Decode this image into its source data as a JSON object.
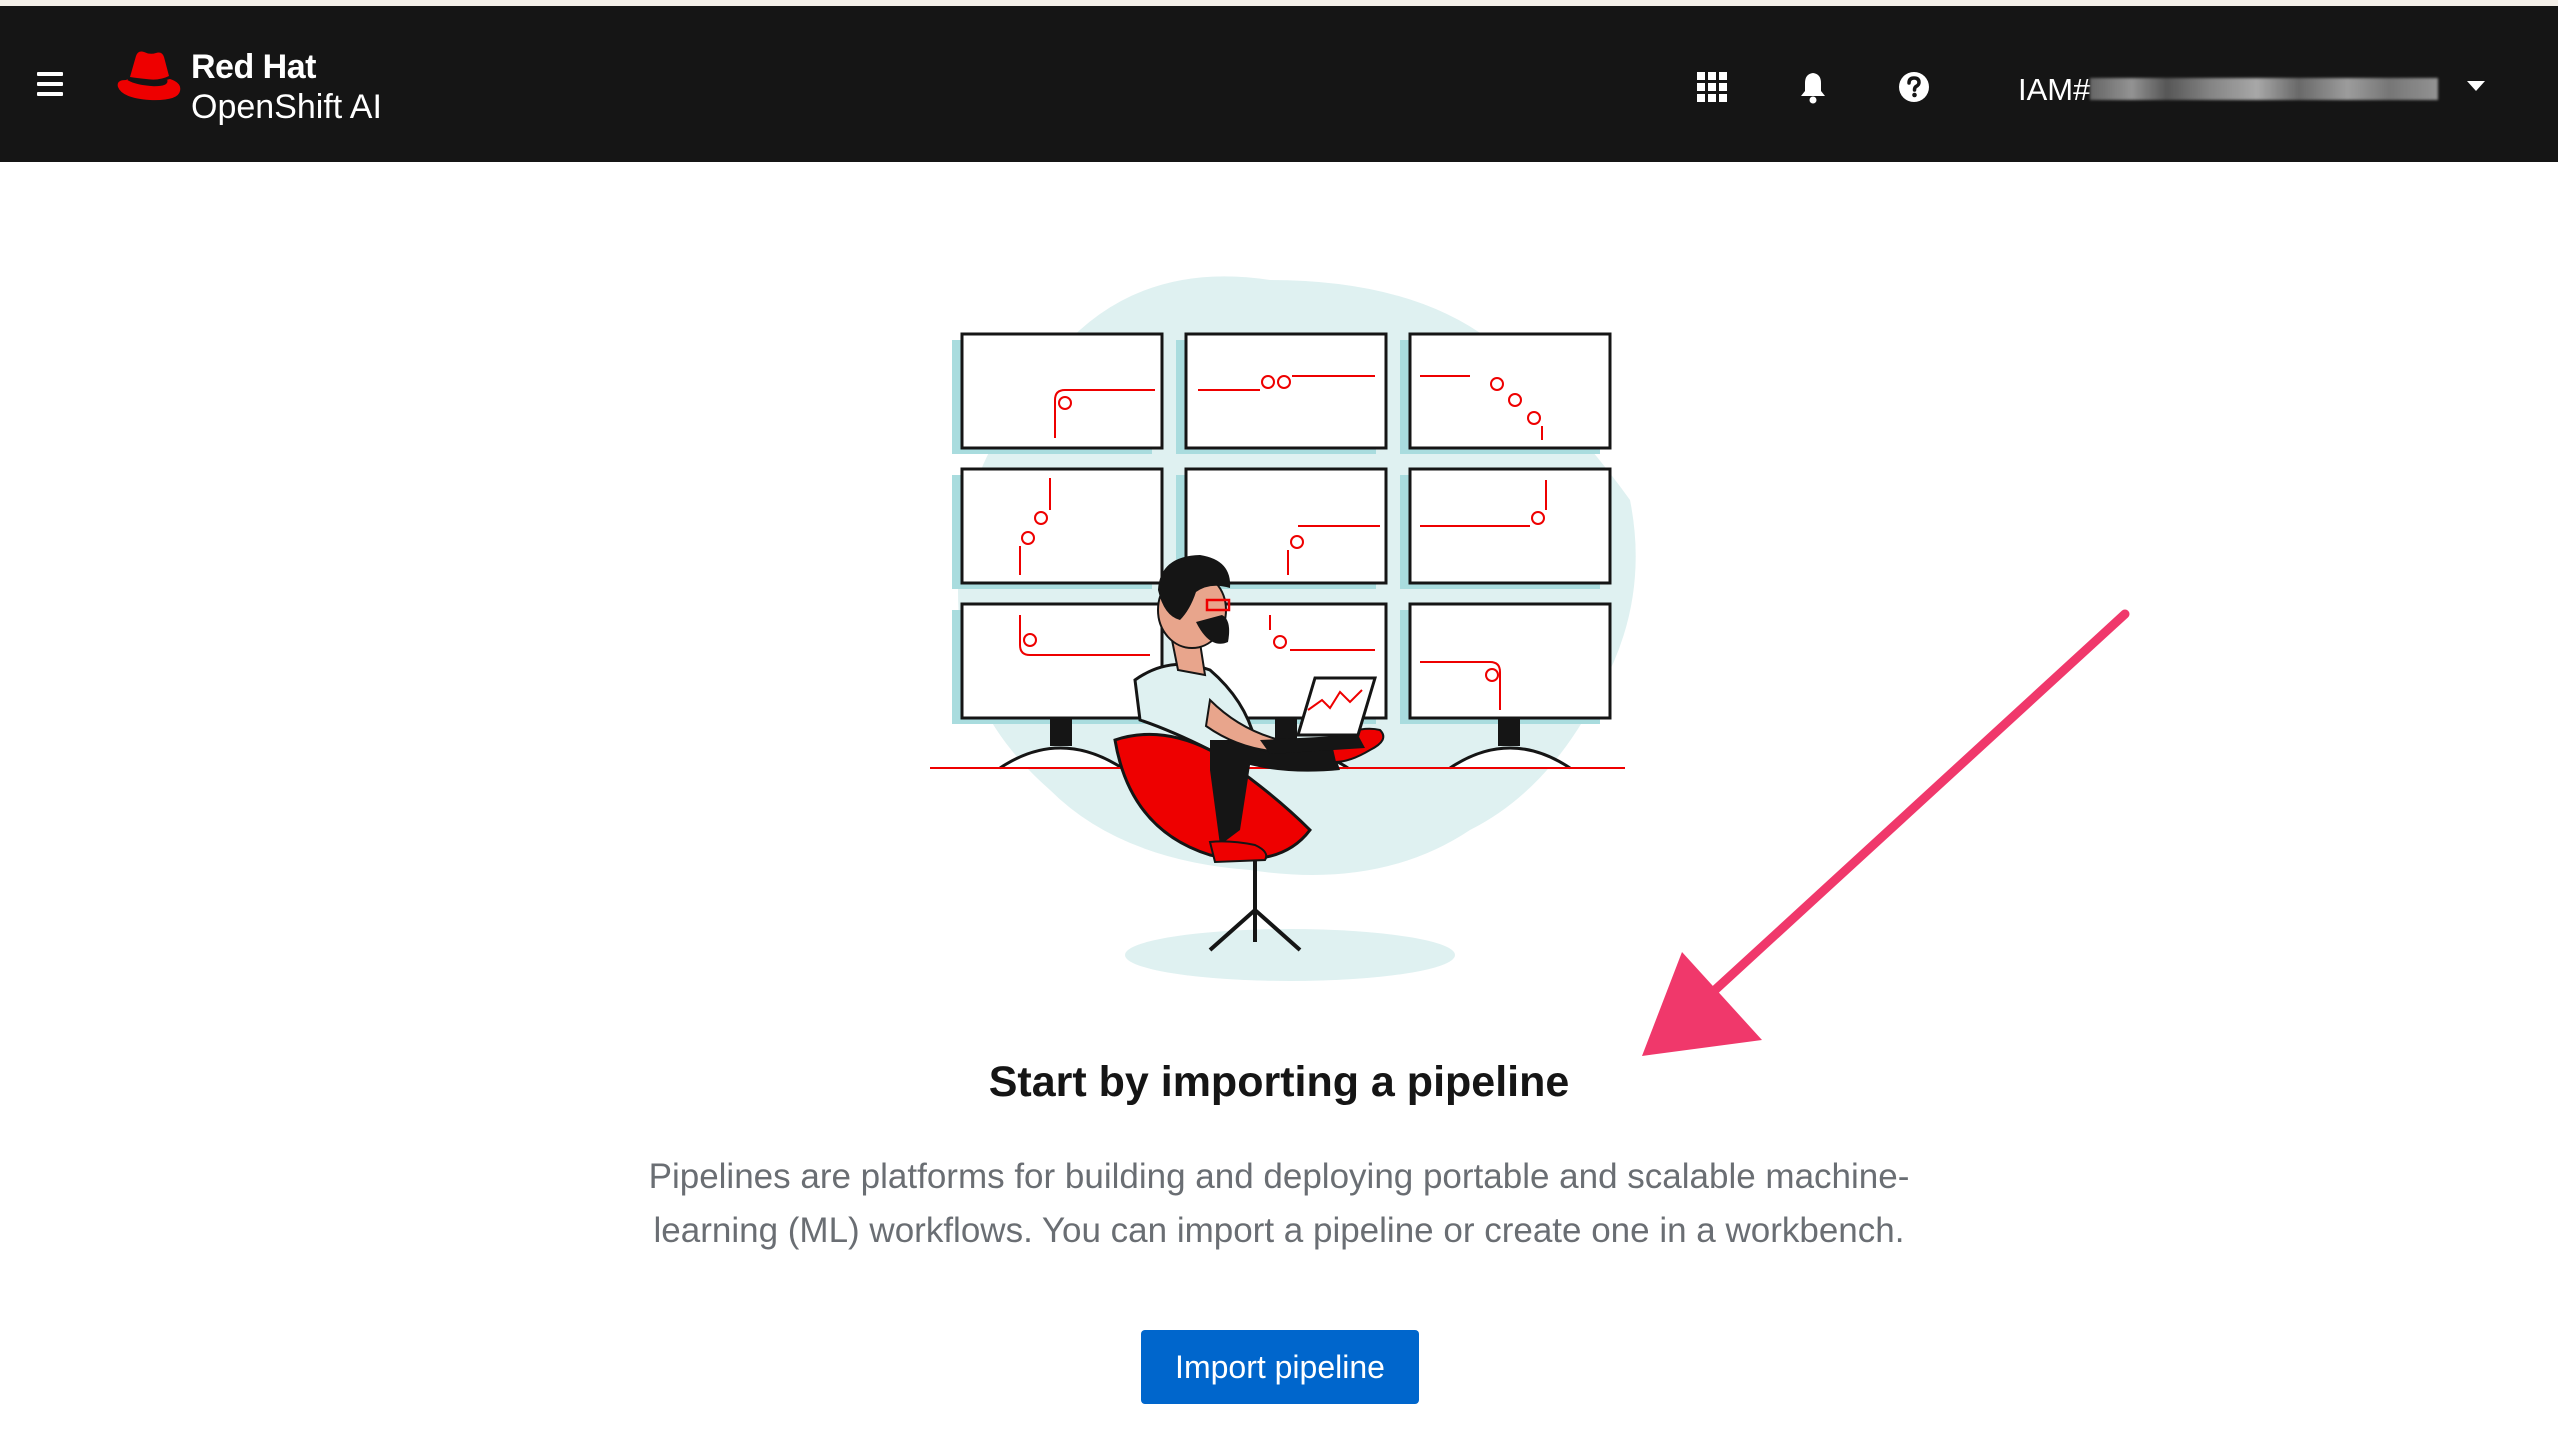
{
  "masthead": {
    "brand": {
      "line1": "Red Hat",
      "line2": "OpenShift AI"
    },
    "icons": [
      "menu-icon",
      "app-launcher-icon",
      "bell-icon",
      "help-icon",
      "caret-down-icon"
    ],
    "user": {
      "prefix": "IAM#",
      "name_obscured": true
    }
  },
  "empty_state": {
    "title": "Start by importing a pipeline",
    "body_line1": "Pipelines are platforms for building and deploying portable and scalable machine-",
    "body_line2": "learning (ML) workflows. You can import a pipeline or create one in a workbench.",
    "primary_action": "Import pipeline"
  },
  "colors": {
    "masthead_bg": "#151515",
    "brand_red": "#ee0000",
    "primary_blue": "#0066cc",
    "annotation_pink": "#f0386b",
    "illustration_teal": "#dff1f1"
  }
}
